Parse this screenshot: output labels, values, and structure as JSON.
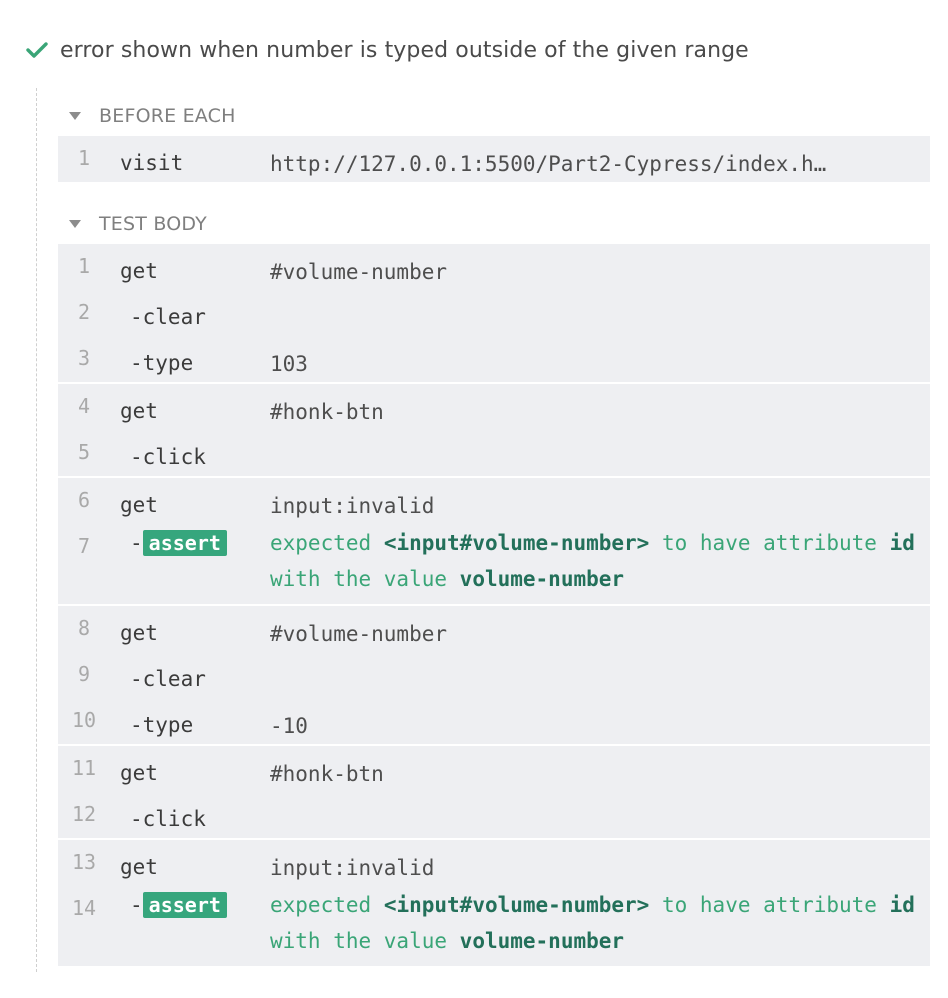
{
  "test": {
    "title": "error shown when number is typed outside of the given range"
  },
  "before_each": {
    "label": "BEFORE EACH",
    "commands": [
      {
        "num": "1",
        "name": "visit",
        "message": "http://127.0.0.1:5500/Part2-Cypress/index.h…"
      }
    ]
  },
  "test_body": {
    "label": "TEST BODY",
    "rows": [
      {
        "num": "1",
        "name": "get",
        "message": "#volume-number"
      },
      {
        "num": "2",
        "name": "-clear",
        "message": ""
      },
      {
        "num": "3",
        "name": "-type",
        "message": "103"
      },
      {
        "num": "4",
        "name": "get",
        "message": "#honk-btn"
      },
      {
        "num": "5",
        "name": "-click",
        "message": ""
      },
      {
        "num": "6",
        "name": "get",
        "message": "input:invalid"
      },
      {
        "num": "7",
        "name": "assert",
        "message": ""
      },
      {
        "num": "8",
        "name": "get",
        "message": "#volume-number"
      },
      {
        "num": "9",
        "name": "-clear",
        "message": ""
      },
      {
        "num": "10",
        "name": "-type",
        "message": "-10"
      },
      {
        "num": "11",
        "name": "get",
        "message": "#honk-btn"
      },
      {
        "num": "12",
        "name": "-click",
        "message": ""
      },
      {
        "num": "13",
        "name": "get",
        "message": "input:invalid"
      },
      {
        "num": "14",
        "name": "assert",
        "message": ""
      }
    ],
    "assert_message": {
      "expected": "expected",
      "subject": "<input#volume-number>",
      "to_have": "to have",
      "attribute": "attribute",
      "attr_name": "id",
      "with_value": "with the value",
      "value": "volume-number"
    }
  },
  "colors": {
    "pass_green": "#36a67d",
    "row_bg": "#eeeff2"
  }
}
